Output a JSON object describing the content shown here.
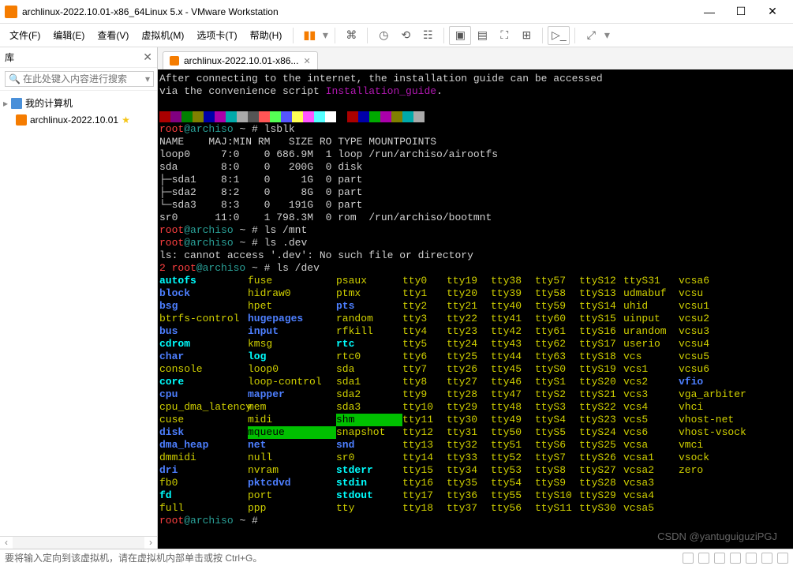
{
  "window": {
    "title": "archlinux-2022.10.01-x86_64Linux 5.x - VMware Workstation",
    "min": "—",
    "max": "☐",
    "close": "✕"
  },
  "menu": [
    "文件(F)",
    "编辑(E)",
    "查看(V)",
    "虚拟机(M)",
    "选项卡(T)",
    "帮助(H)"
  ],
  "sidebar": {
    "title": "库",
    "search_placeholder": "在此处键入内容进行搜索",
    "root": "我的计算机",
    "child": "archlinux-2022.10.01"
  },
  "tab": {
    "label": "archlinux-2022.10.01-x86..."
  },
  "terminal": {
    "intro1": "After connecting to the internet, the installation guide can be accessed",
    "intro2_a": "via the convenience script ",
    "intro2_b": "Installation_guide",
    "intro2_c": ".",
    "prompt_user": "root",
    "prompt_host": "@archiso",
    "prompt_path": " ~ # ",
    "cmd1": "lsblk",
    "lsblk_hdr": "NAME    MAJ:MIN RM   SIZE RO TYPE MOUNTPOINTS",
    "lsblk_rows": [
      "loop0     7:0    0 686.9M  1 loop /run/archiso/airootfs",
      "sda       8:0    0   200G  0 disk",
      "├─sda1    8:1    0     1G  0 part",
      "├─sda2    8:2    0     8G  0 part",
      "└─sda3    8:3    0   191G  0 part",
      "sr0      11:0    1 798.3M  0 rom  /run/archiso/bootmnt"
    ],
    "cmd2": "ls /mnt",
    "cmd3": "ls .dev",
    "err1": "ls: cannot access '.dev': No such file or directory",
    "errcode": "2 ",
    "cmd4": "ls /dev",
    "dev": {
      "rows": [
        [
          [
            "autofs",
            "c-cyan"
          ],
          [
            "fuse",
            "c-yellow"
          ],
          [
            "psaux",
            "c-yellow"
          ],
          [
            "tty0",
            "c-yellow"
          ],
          [
            "tty19",
            "c-yellow"
          ],
          [
            "tty38",
            "c-yellow"
          ],
          [
            "tty57",
            "c-yellow"
          ],
          [
            "ttyS12",
            "c-yellow"
          ],
          [
            "ttyS31",
            "c-yellow"
          ],
          [
            "vcsa6",
            "c-yellow"
          ]
        ],
        [
          [
            "block",
            "c-blue"
          ],
          [
            "hidraw0",
            "c-yellow"
          ],
          [
            "ptmx",
            "c-yellow"
          ],
          [
            "tty1",
            "c-yellow"
          ],
          [
            "tty20",
            "c-yellow"
          ],
          [
            "tty39",
            "c-yellow"
          ],
          [
            "tty58",
            "c-yellow"
          ],
          [
            "ttyS13",
            "c-yellow"
          ],
          [
            "udmabuf",
            "c-yellow"
          ],
          [
            "vcsu",
            "c-yellow"
          ]
        ],
        [
          [
            "bsg",
            "c-blue"
          ],
          [
            "hpet",
            "c-yellow"
          ],
          [
            "pts",
            "c-blue"
          ],
          [
            "tty2",
            "c-yellow"
          ],
          [
            "tty21",
            "c-yellow"
          ],
          [
            "tty40",
            "c-yellow"
          ],
          [
            "tty59",
            "c-yellow"
          ],
          [
            "ttyS14",
            "c-yellow"
          ],
          [
            "uhid",
            "c-yellow"
          ],
          [
            "vcsu1",
            "c-yellow"
          ]
        ],
        [
          [
            "btrfs-control",
            "c-yellow"
          ],
          [
            "hugepages",
            "c-blue"
          ],
          [
            "random",
            "c-yellow"
          ],
          [
            "tty3",
            "c-yellow"
          ],
          [
            "tty22",
            "c-yellow"
          ],
          [
            "tty41",
            "c-yellow"
          ],
          [
            "tty60",
            "c-yellow"
          ],
          [
            "ttyS15",
            "c-yellow"
          ],
          [
            "uinput",
            "c-yellow"
          ],
          [
            "vcsu2",
            "c-yellow"
          ]
        ],
        [
          [
            "bus",
            "c-blue"
          ],
          [
            "input",
            "c-blue"
          ],
          [
            "rfkill",
            "c-yellow"
          ],
          [
            "tty4",
            "c-yellow"
          ],
          [
            "tty23",
            "c-yellow"
          ],
          [
            "tty42",
            "c-yellow"
          ],
          [
            "tty61",
            "c-yellow"
          ],
          [
            "ttyS16",
            "c-yellow"
          ],
          [
            "urandom",
            "c-yellow"
          ],
          [
            "vcsu3",
            "c-yellow"
          ]
        ],
        [
          [
            "cdrom",
            "c-cyan"
          ],
          [
            "kmsg",
            "c-yellow"
          ],
          [
            "rtc",
            "c-cyan"
          ],
          [
            "tty5",
            "c-yellow"
          ],
          [
            "tty24",
            "c-yellow"
          ],
          [
            "tty43",
            "c-yellow"
          ],
          [
            "tty62",
            "c-yellow"
          ],
          [
            "ttyS17",
            "c-yellow"
          ],
          [
            "userio",
            "c-yellow"
          ],
          [
            "vcsu4",
            "c-yellow"
          ]
        ],
        [
          [
            "char",
            "c-blue"
          ],
          [
            "log",
            "c-cyan"
          ],
          [
            "rtc0",
            "c-yellow"
          ],
          [
            "tty6",
            "c-yellow"
          ],
          [
            "tty25",
            "c-yellow"
          ],
          [
            "tty44",
            "c-yellow"
          ],
          [
            "tty63",
            "c-yellow"
          ],
          [
            "ttyS18",
            "c-yellow"
          ],
          [
            "vcs",
            "c-yellow"
          ],
          [
            "vcsu5",
            "c-yellow"
          ]
        ],
        [
          [
            "console",
            "c-yellow"
          ],
          [
            "loop0",
            "c-yellow"
          ],
          [
            "sda",
            "c-yellow"
          ],
          [
            "tty7",
            "c-yellow"
          ],
          [
            "tty26",
            "c-yellow"
          ],
          [
            "tty45",
            "c-yellow"
          ],
          [
            "ttyS0",
            "c-yellow"
          ],
          [
            "ttyS19",
            "c-yellow"
          ],
          [
            "vcs1",
            "c-yellow"
          ],
          [
            "vcsu6",
            "c-yellow"
          ]
        ],
        [
          [
            "core",
            "c-cyan"
          ],
          [
            "loop-control",
            "c-yellow"
          ],
          [
            "sda1",
            "c-yellow"
          ],
          [
            "tty8",
            "c-yellow"
          ],
          [
            "tty27",
            "c-yellow"
          ],
          [
            "tty46",
            "c-yellow"
          ],
          [
            "ttyS1",
            "c-yellow"
          ],
          [
            "ttyS20",
            "c-yellow"
          ],
          [
            "vcs2",
            "c-yellow"
          ],
          [
            "vfio",
            "c-blue"
          ]
        ],
        [
          [
            "cpu",
            "c-blue"
          ],
          [
            "mapper",
            "c-blue"
          ],
          [
            "sda2",
            "c-yellow"
          ],
          [
            "tty9",
            "c-yellow"
          ],
          [
            "tty28",
            "c-yellow"
          ],
          [
            "tty47",
            "c-yellow"
          ],
          [
            "ttyS2",
            "c-yellow"
          ],
          [
            "ttyS21",
            "c-yellow"
          ],
          [
            "vcs3",
            "c-yellow"
          ],
          [
            "vga_arbiter",
            "c-yellow"
          ]
        ],
        [
          [
            "cpu_dma_latency",
            "c-yellow"
          ],
          [
            "mem",
            "c-yellow"
          ],
          [
            "sda3",
            "c-yellow"
          ],
          [
            "tty10",
            "c-yellow"
          ],
          [
            "tty29",
            "c-yellow"
          ],
          [
            "tty48",
            "c-yellow"
          ],
          [
            "ttyS3",
            "c-yellow"
          ],
          [
            "ttyS22",
            "c-yellow"
          ],
          [
            "vcs4",
            "c-yellow"
          ],
          [
            "vhci",
            "c-yellow"
          ]
        ],
        [
          [
            "cuse",
            "c-yellow"
          ],
          [
            "midi",
            "c-yellow"
          ],
          [
            "shm",
            "c-bggreen"
          ],
          [
            "tty11",
            "c-yellow"
          ],
          [
            "tty30",
            "c-yellow"
          ],
          [
            "tty49",
            "c-yellow"
          ],
          [
            "ttyS4",
            "c-yellow"
          ],
          [
            "ttyS23",
            "c-yellow"
          ],
          [
            "vcs5",
            "c-yellow"
          ],
          [
            "vhost-net",
            "c-yellow"
          ]
        ],
        [
          [
            "disk",
            "c-blue"
          ],
          [
            "mqueue",
            "c-bggreen"
          ],
          [
            "snapshot",
            "c-yellow"
          ],
          [
            "tty12",
            "c-yellow"
          ],
          [
            "tty31",
            "c-yellow"
          ],
          [
            "tty50",
            "c-yellow"
          ],
          [
            "ttyS5",
            "c-yellow"
          ],
          [
            "ttyS24",
            "c-yellow"
          ],
          [
            "vcs6",
            "c-yellow"
          ],
          [
            "vhost-vsock",
            "c-yellow"
          ]
        ],
        [
          [
            "dma_heap",
            "c-blue"
          ],
          [
            "net",
            "c-blue"
          ],
          [
            "snd",
            "c-blue"
          ],
          [
            "tty13",
            "c-yellow"
          ],
          [
            "tty32",
            "c-yellow"
          ],
          [
            "tty51",
            "c-yellow"
          ],
          [
            "ttyS6",
            "c-yellow"
          ],
          [
            "ttyS25",
            "c-yellow"
          ],
          [
            "vcsa",
            "c-yellow"
          ],
          [
            "vmci",
            "c-yellow"
          ]
        ],
        [
          [
            "dmmidi",
            "c-yellow"
          ],
          [
            "null",
            "c-yellow"
          ],
          [
            "sr0",
            "c-yellow"
          ],
          [
            "tty14",
            "c-yellow"
          ],
          [
            "tty33",
            "c-yellow"
          ],
          [
            "tty52",
            "c-yellow"
          ],
          [
            "ttyS7",
            "c-yellow"
          ],
          [
            "ttyS26",
            "c-yellow"
          ],
          [
            "vcsa1",
            "c-yellow"
          ],
          [
            "vsock",
            "c-yellow"
          ]
        ],
        [
          [
            "dri",
            "c-blue"
          ],
          [
            "nvram",
            "c-yellow"
          ],
          [
            "stderr",
            "c-cyan"
          ],
          [
            "tty15",
            "c-yellow"
          ],
          [
            "tty34",
            "c-yellow"
          ],
          [
            "tty53",
            "c-yellow"
          ],
          [
            "ttyS8",
            "c-yellow"
          ],
          [
            "ttyS27",
            "c-yellow"
          ],
          [
            "vcsa2",
            "c-yellow"
          ],
          [
            "zero",
            "c-yellow"
          ]
        ],
        [
          [
            "fb0",
            "c-yellow"
          ],
          [
            "pktcdvd",
            "c-blue"
          ],
          [
            "stdin",
            "c-cyan"
          ],
          [
            "tty16",
            "c-yellow"
          ],
          [
            "tty35",
            "c-yellow"
          ],
          [
            "tty54",
            "c-yellow"
          ],
          [
            "ttyS9",
            "c-yellow"
          ],
          [
            "ttyS28",
            "c-yellow"
          ],
          [
            "vcsa3",
            "c-yellow"
          ],
          [
            "",
            ""
          ]
        ],
        [
          [
            "fd",
            "c-cyan"
          ],
          [
            "port",
            "c-yellow"
          ],
          [
            "stdout",
            "c-cyan"
          ],
          [
            "tty17",
            "c-yellow"
          ],
          [
            "tty36",
            "c-yellow"
          ],
          [
            "tty55",
            "c-yellow"
          ],
          [
            "ttyS10",
            "c-yellow"
          ],
          [
            "ttyS29",
            "c-yellow"
          ],
          [
            "vcsa4",
            "c-yellow"
          ],
          [
            "",
            ""
          ]
        ],
        [
          [
            "full",
            "c-yellow"
          ],
          [
            "ppp",
            "c-yellow"
          ],
          [
            "tty",
            "c-yellow"
          ],
          [
            "tty18",
            "c-yellow"
          ],
          [
            "tty37",
            "c-yellow"
          ],
          [
            "tty56",
            "c-yellow"
          ],
          [
            "ttyS11",
            "c-yellow"
          ],
          [
            "ttyS30",
            "c-yellow"
          ],
          [
            "vcsa5",
            "c-yellow"
          ],
          [
            "",
            ""
          ]
        ]
      ]
    }
  },
  "statusbar": {
    "text": "要将输入定向到该虚拟机，请在虚拟机内部单击或按 Ctrl+G。"
  },
  "watermark": "CSDN @yantuguiguziPGJ",
  "colorbar": [
    "#a00",
    "#800080",
    "#008000",
    "#808000",
    "#00a",
    "#a0a",
    "#0aa",
    "#aaa",
    "#555",
    "#f55",
    "#5f5",
    "#55f",
    "#ff5",
    "#f5f",
    "#5ff",
    "#fff",
    "#000",
    "#a00",
    "#00a",
    "#0a0",
    "#a0a",
    "#808000",
    "#0aa",
    "#aaa"
  ]
}
